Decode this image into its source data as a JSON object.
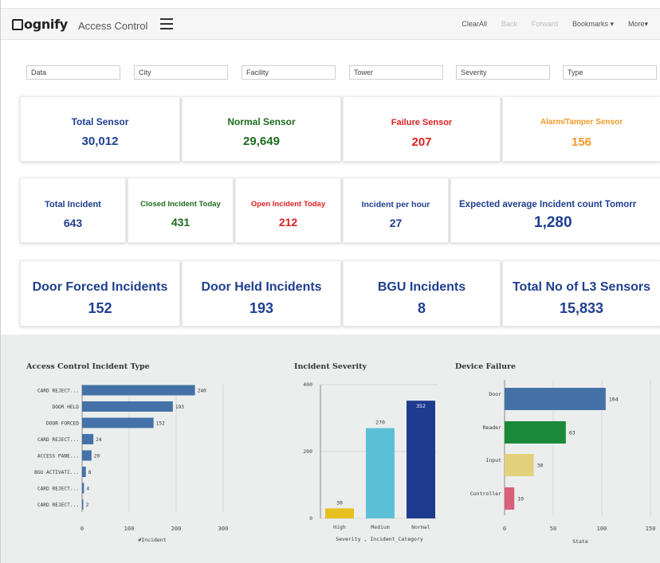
{
  "header": {
    "logo_text": "Qognify",
    "app_title": "Access Control",
    "nav": [
      {
        "label": "ClearAll",
        "enabled": true
      },
      {
        "label": "Back",
        "enabled": false
      },
      {
        "label": "Forward",
        "enabled": false
      },
      {
        "label": "Bookmarks ▾",
        "enabled": true
      },
      {
        "label": "More▾",
        "enabled": true
      }
    ]
  },
  "filters": [
    "Data",
    "City",
    "Facility",
    "Tower",
    "Severity",
    "Type"
  ],
  "kpi_row1": [
    {
      "label": "Total Sensor",
      "value": "30,012",
      "color": "#1f3f8f"
    },
    {
      "label": "Normal Sensor",
      "value": "29,649",
      "color": "#1e6b1e"
    },
    {
      "label": "Failure Sensor",
      "value": "207",
      "color": "#e02020"
    },
    {
      "label": "Alarm/Tamper Sensor",
      "value": "156",
      "color": "#f39a2b"
    }
  ],
  "kpi_row2": [
    {
      "label": "Total Incident",
      "value": "643",
      "color": "#1f3f8f"
    },
    {
      "label": "Closed Incident Today",
      "value": "431",
      "color": "#1e6b1e"
    },
    {
      "label": "Open Incident Today",
      "value": "212",
      "color": "#e02020"
    },
    {
      "label": "Incident per hour",
      "value": "27",
      "color": "#1f3f8f"
    },
    {
      "label": "Expected average Incident count Tomorr",
      "value": "1,280",
      "color": "#1f3f8f"
    }
  ],
  "kpi_row3": [
    {
      "label": "Door Forced Incidents",
      "value": "152",
      "color": "#1f3f8f"
    },
    {
      "label": "Door Held Incidents",
      "value": "193",
      "color": "#1f3f8f"
    },
    {
      "label": "BGU Incidents",
      "value": "8",
      "color": "#1f3f8f"
    },
    {
      "label": "Total No of L3 Sensors",
      "value": "15,833",
      "color": "#1f3f8f"
    }
  ],
  "chart_data": [
    {
      "type": "bar",
      "orientation": "horizontal",
      "title": "Access Control Incident Type",
      "categories": [
        "CARD REJECT...",
        "DOOR HELD",
        "DOOR FORCED",
        "CARD REJECT...",
        "ACCESS PANE...",
        "BGU ACTIVATI...",
        "CARD REJECT...",
        "CARD REJECT..."
      ],
      "values": [
        240,
        193,
        152,
        24,
        20,
        8,
        4,
        2
      ],
      "value_labels": [
        "240",
        "193",
        "152",
        "24",
        "20",
        "8",
        "4",
        "2"
      ],
      "xlabel": "#Incident",
      "xlim": [
        0,
        300
      ],
      "xticks": [
        "0",
        "100",
        "200",
        "300"
      ],
      "color": "#4472a8",
      "grid": true
    },
    {
      "type": "bar",
      "orientation": "vertical",
      "title": "Incident Severity",
      "categories": [
        "High",
        "Medium",
        "Normal"
      ],
      "values": [
        30,
        270,
        352
      ],
      "value_labels": [
        "30",
        "270",
        "352"
      ],
      "colors": [
        "#e8c020",
        "#5bc0d6",
        "#1f3b8f"
      ],
      "xlabel": "Severity , Incident_Category",
      "ylim": [
        0,
        400
      ],
      "yticks": [
        "0",
        "200",
        "400"
      ],
      "grid": true
    },
    {
      "type": "bar",
      "orientation": "horizontal",
      "title": "Device Failure",
      "categories": [
        "Door",
        "Reader",
        "Input",
        "Controller"
      ],
      "values": [
        104,
        63,
        30,
        10
      ],
      "value_labels": [
        "104",
        "63",
        "30",
        "10"
      ],
      "colors": [
        "#4472a8",
        "#1a8a3a",
        "#e3d07a",
        "#d9607a"
      ],
      "xlabel": "State",
      "xlim": [
        0,
        150
      ],
      "xticks": [
        "0",
        "50",
        "100",
        "150"
      ],
      "grid": true
    }
  ]
}
